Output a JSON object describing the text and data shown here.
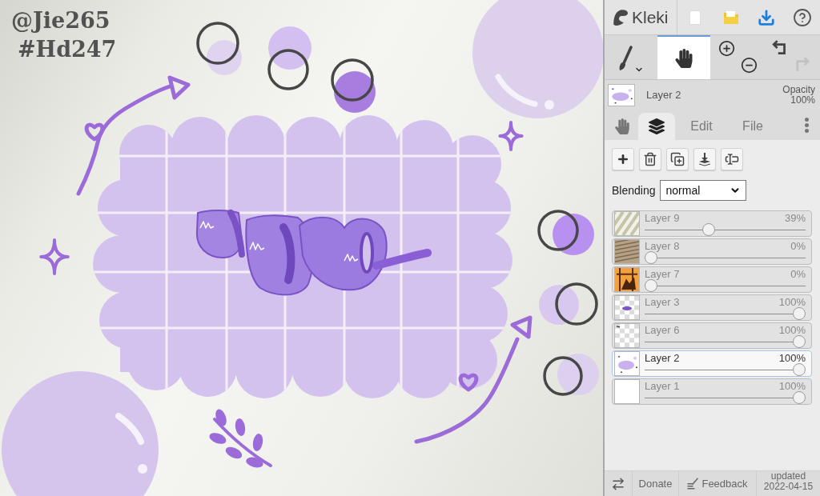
{
  "canvas": {
    "signature": [
      "@Jie265",
      "#Hd247"
    ]
  },
  "topbar": {
    "logo": "Kleki"
  },
  "tools": [
    {
      "kind": "brush",
      "selected": false
    },
    {
      "kind": "hand",
      "selected": true
    }
  ],
  "history": [
    {
      "kind": "undo",
      "disabled": false
    },
    {
      "kind": "redo",
      "disabled": true
    }
  ],
  "current_layer": {
    "kind": "cloud",
    "name": "Layer 2",
    "opacity_label": "Opacity",
    "opacity": "100%"
  },
  "tabs": [
    {
      "kind": "hand",
      "selected": false
    },
    {
      "kind": "layers",
      "selected": true
    },
    {
      "kind": "label",
      "label": "Edit",
      "selected": false
    },
    {
      "kind": "label",
      "label": "File",
      "selected": false
    }
  ],
  "blending": {
    "label": "Blending",
    "value": "normal"
  },
  "layers": [
    {
      "kind": "stripes",
      "name": "Layer 9",
      "opacity": "39%",
      "level": 0.39,
      "selected": false
    },
    {
      "kind": "texture",
      "name": "Layer 8",
      "opacity": "0%",
      "level": 0,
      "selected": false
    },
    {
      "kind": "photo",
      "name": "Layer 7",
      "opacity": "0%",
      "level": 0,
      "selected": false
    },
    {
      "kind": "checker-ribbon",
      "name": "Layer 3",
      "opacity": "100%",
      "level": 1,
      "selected": false
    },
    {
      "kind": "checker-mark",
      "name": "Layer 6",
      "opacity": "100%",
      "level": 1,
      "selected": false
    },
    {
      "kind": "cloud",
      "name": "Layer 2",
      "opacity": "100%",
      "level": 1,
      "selected": true
    },
    {
      "kind": "blank",
      "name": "Layer 1",
      "opacity": "100%",
      "level": 1,
      "selected": false
    }
  ],
  "footer": {
    "donate": "Donate",
    "feedback": "Feedback",
    "updated": "updated 2022-04-15"
  }
}
